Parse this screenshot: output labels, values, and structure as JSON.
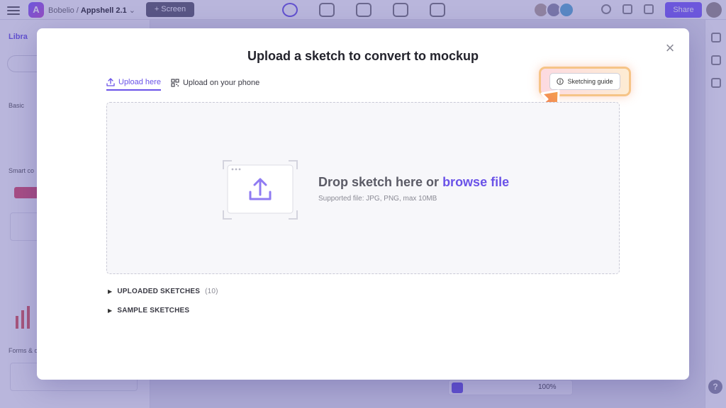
{
  "app": {
    "crumb_owner": "Bobelio",
    "crumb_separator": "/",
    "project_name": "Appshell 2.1",
    "add_screen_label": "+ Screen",
    "share_label": "Share",
    "help_label": "?",
    "zoom_label": "100%",
    "library_tab_label": "Libra",
    "basic_label": "Basic",
    "smart_label": "Smart co",
    "forms_label": "Forms & d"
  },
  "modal": {
    "title": "Upload a sketch to convert to mockup",
    "close_label": "×",
    "tabs": [
      {
        "label": "Upload here",
        "active": true
      },
      {
        "label": "Upload on your phone",
        "active": false
      }
    ],
    "guide_label": "Sketching guide",
    "dropzone": {
      "lead": "Drop sketch here or ",
      "link": "browse file",
      "supported": "Supported file: JPG, PNG, max 10MB"
    },
    "sections": [
      {
        "label": "UPLOADED SKETCHES",
        "count": "(10)"
      },
      {
        "label": "SAMPLE SKETCHES",
        "count": ""
      }
    ]
  },
  "colors": {
    "accent": "#6a52e8",
    "overlay": "#5850ac",
    "arrow_start": "#f4a34a",
    "arrow_end": "#ef5a7a"
  },
  "icons": {
    "upload_tab": "upload-icon",
    "phone_tab": "qr-code-icon",
    "guide": "info-icon",
    "close": "close-icon",
    "dropzone": "upload-tray-icon",
    "section": "caret-right-icon"
  }
}
